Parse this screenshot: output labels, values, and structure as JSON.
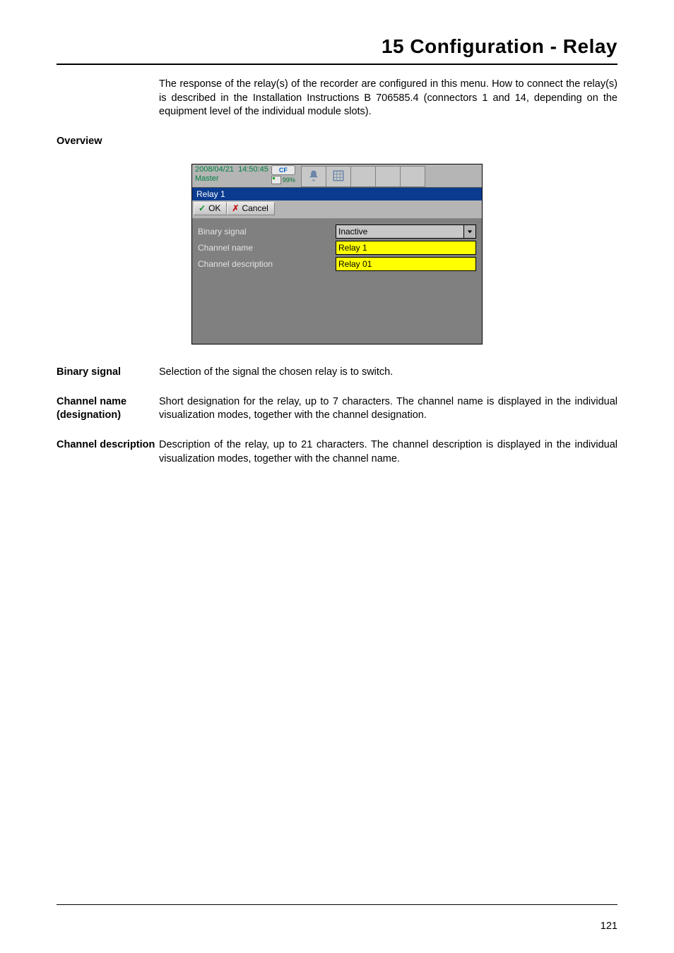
{
  "chapter_title": "15 Configuration - Relay",
  "intro_text": "The response of the relay(s) of the recorder are configured in this menu. How to connect the relay(s) is described in the Installation Instructions B 706585.4 (connectors 1 and 14, depending on the equipment level of the individual module slots).",
  "overview": {
    "label": "Overview"
  },
  "screenshot": {
    "date": "2008/04/21",
    "time": "14:50:45",
    "user": "Master",
    "cf_label": "CF",
    "pct": "99%",
    "window_title": "Relay 1",
    "ok_label": "OK",
    "cancel_label": "Cancel",
    "rows": {
      "binary_signal": {
        "label": "Binary signal",
        "value": "Inactive"
      },
      "channel_name": {
        "label": "Channel name",
        "value": "Relay 1"
      },
      "channel_description": {
        "label": "Channel description",
        "value": "Relay  01"
      }
    }
  },
  "defs": {
    "binary_signal": {
      "label": "Binary signal",
      "text": "Selection of the signal the chosen relay is to switch."
    },
    "channel_name": {
      "label": "Channel name (designation)",
      "text": "Short designation for the relay, up to 7 characters. The channel name is displayed in the individual visualization modes, together with the channel designation."
    },
    "channel_description": {
      "label": "Channel description",
      "text": "Description of the relay, up to 21 characters. The channel description is displayed in the individual visualization modes, together with the channel name."
    }
  },
  "page_number": "121"
}
